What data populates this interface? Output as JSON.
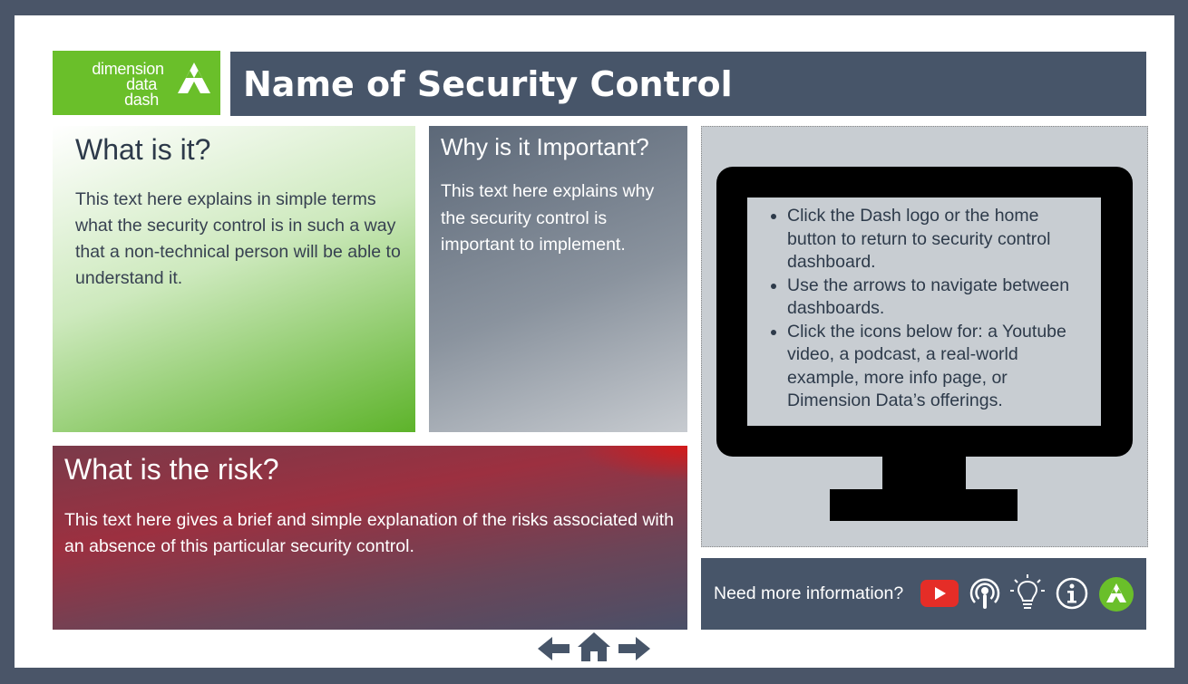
{
  "logo": {
    "line1": "dimension",
    "line2": "data",
    "line3": "dash"
  },
  "title": "Name of Security Control",
  "what": {
    "heading": "What is it?",
    "body": "This text here explains in simple terms what the security control is in such a way that a non-technical person will be able to understand it."
  },
  "why": {
    "heading": "Why is it Important?",
    "body": "This text here explains why the security control is important to implement."
  },
  "risk": {
    "heading": "What is the risk?",
    "body": "This text here gives a brief and simple explanation of the risks associated with an absence of this particular security control."
  },
  "instructions": [
    "Click the Dash logo or the home button to return to security control dashboard.",
    "Use the arrows to navigate between dashboards.",
    "Click the icons below for: a Youtube video, a podcast, a real-world example, more info page, or Dimension Data’s offerings."
  ],
  "info_bar": {
    "label": "Need more information?",
    "icons": [
      "youtube-icon",
      "podcast-icon",
      "lightbulb-icon",
      "info-icon",
      "dimension-data-icon"
    ]
  },
  "nav": {
    "icons": [
      "arrow-left-icon",
      "home-icon",
      "arrow-right-icon"
    ]
  },
  "colors": {
    "green": "#6abf2a",
    "slate": "#475569",
    "red": "#b5232b",
    "youtube": "#e52d27"
  }
}
